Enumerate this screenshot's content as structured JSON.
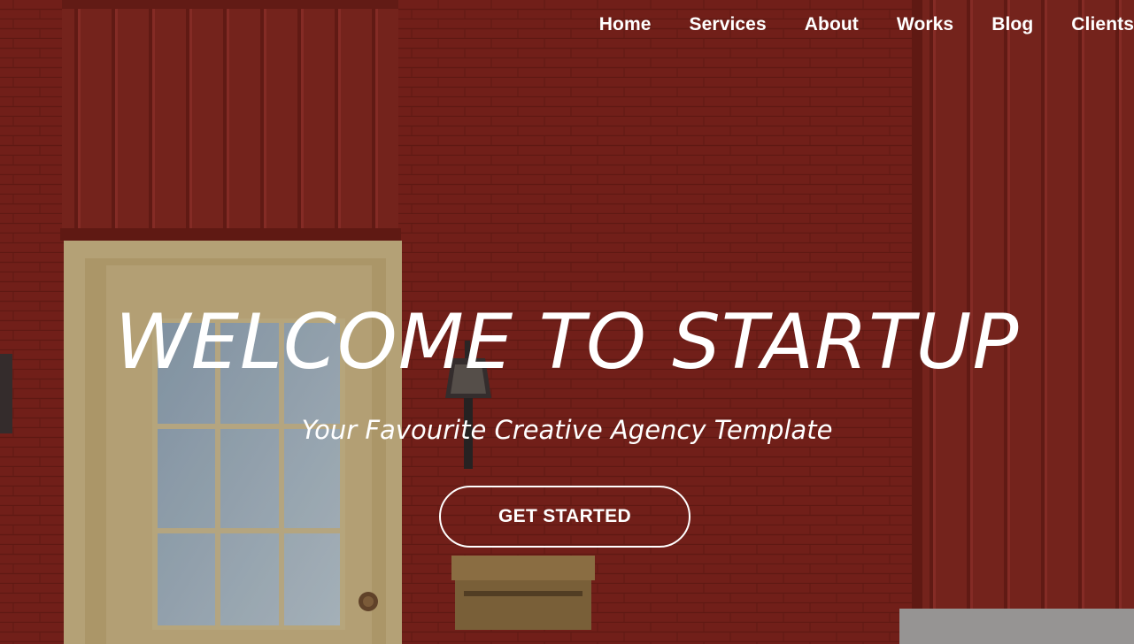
{
  "nav": {
    "items": [
      {
        "label": "Home"
      },
      {
        "label": "Services"
      },
      {
        "label": "About"
      },
      {
        "label": "Works"
      },
      {
        "label": "Blog"
      },
      {
        "label": "Clients"
      }
    ]
  },
  "hero": {
    "title": "WELCOME TO STARTUP",
    "subtitle": "Your Favourite Creative Agency Template",
    "cta_label": "GET STARTED"
  },
  "colors": {
    "brick": "#7e231c",
    "text": "#ffffff",
    "door_frame": "#d1bb8a",
    "glass": "#aebdc8"
  }
}
